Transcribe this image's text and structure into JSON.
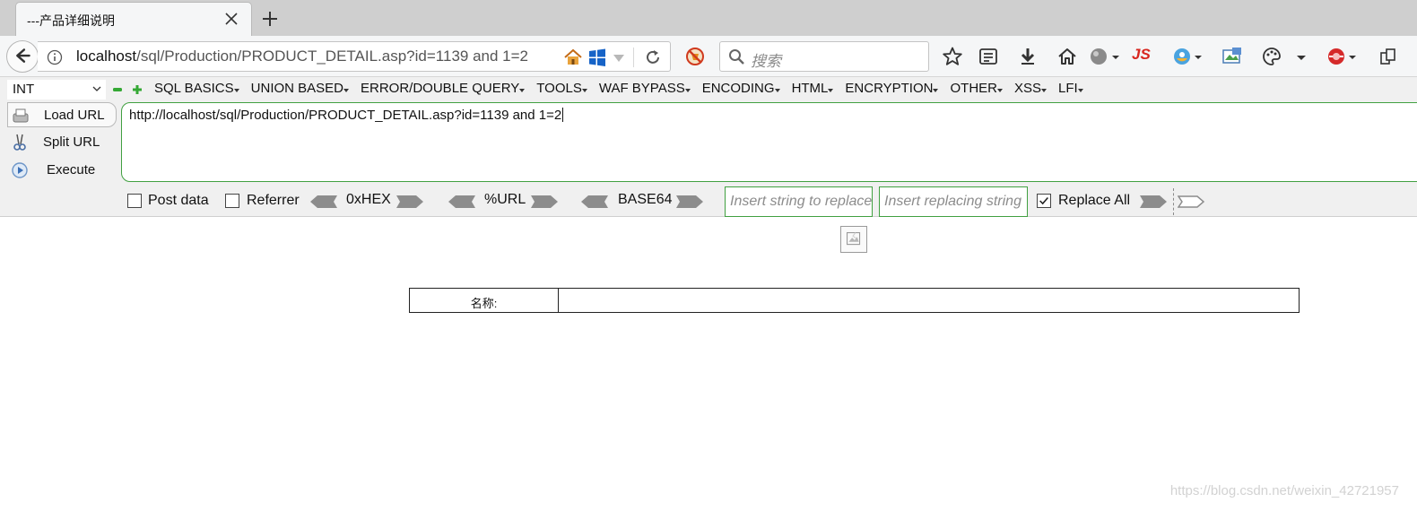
{
  "tab": {
    "title": "---产品详细说明"
  },
  "navbar": {
    "url_host": "localhost",
    "url_path": "/sql/Production/PRODUCT_DETAIL.asp?id=1139 and 1=2",
    "search_placeholder": "搜索",
    "js_badge": "JS"
  },
  "hackbar": {
    "select_value": "INT",
    "menu": [
      "SQL BASICS",
      "UNION BASED",
      "ERROR/DOUBLE QUERY",
      "TOOLS",
      "WAF BYPASS",
      "ENCODING",
      "HTML",
      "ENCRYPTION",
      "OTHER",
      "XSS",
      "LFI"
    ],
    "buttons": {
      "load": "Load URL",
      "split": "Split URL",
      "execute": "Execute"
    },
    "textarea": "http://localhost/sql/Production/PRODUCT_DETAIL.asp?id=1139 and 1=2",
    "post_data": "Post data",
    "referrer": "Referrer",
    "hex": "0xHEX",
    "url": "%URL",
    "base64": "BASE64",
    "replace_placeholder": "Insert string to replace",
    "replacing_placeholder": "Insert replacing string",
    "replace_all": "Replace All"
  },
  "page": {
    "name_label": "名称:",
    "name_value": ""
  },
  "watermark": "https://blog.csdn.net/weixin_42721957"
}
